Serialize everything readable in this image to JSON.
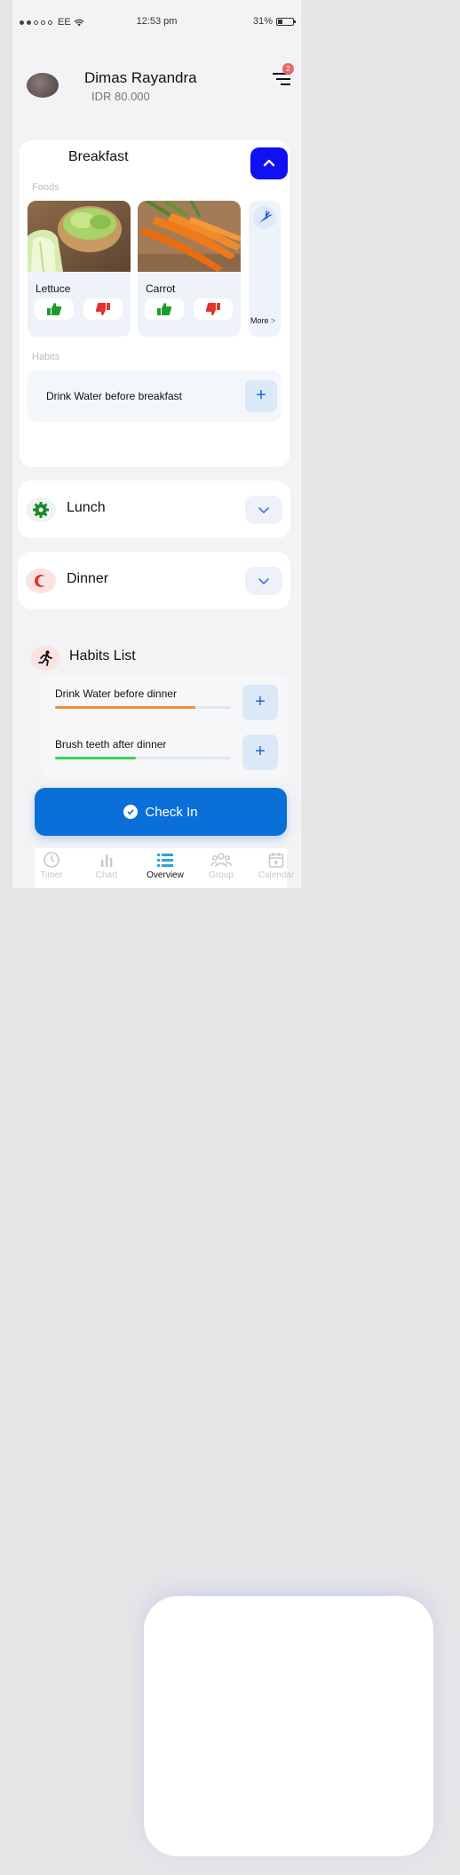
{
  "status_bar": {
    "carrier": "EE",
    "time": "12:53 pm",
    "battery": "31%",
    "battery_level": 0.31
  },
  "user": {
    "name": "Dimas Rayandra",
    "balance": "IDR 80.000",
    "notification_count": "2"
  },
  "breakfast": {
    "title": "Breakfast",
    "foods_label": "Foods",
    "foods": [
      {
        "name": "Lettuce",
        "image": "lettuce-photo"
      },
      {
        "name": "Carrot",
        "image": "carrot-photo"
      }
    ],
    "more_label": "More",
    "more_chevron": ">",
    "habits_label": "Habits",
    "habits": [
      {
        "name": "Drink Water before breakfast"
      }
    ]
  },
  "lunch": {
    "title": "Lunch",
    "icon": "gear-icon"
  },
  "dinner": {
    "title": "Dinner",
    "icon": "crescent-icon"
  },
  "habits_list": {
    "title": "Habits List",
    "items": [
      {
        "name": "Drink Water before dinner",
        "progress": 0.8,
        "color": "#f28b30"
      },
      {
        "name": "Brush teeth after dinner",
        "progress": 0.46,
        "color": "#3dcf5a"
      }
    ]
  },
  "check_in": {
    "label": "Check In"
  },
  "tabs": [
    {
      "label": "Timer",
      "icon": "clock-icon"
    },
    {
      "label": "Chart",
      "icon": "bar-chart-icon"
    },
    {
      "label": "Overview",
      "icon": "list-icon",
      "active": true
    },
    {
      "label": "Group",
      "icon": "group-icon"
    },
    {
      "label": "Calendar",
      "icon": "calendar-icon"
    }
  ],
  "colors": {
    "primary": "#0b6fd8",
    "accent_blue": "#1010f0",
    "like": "#1a9e2b",
    "dislike": "#e2332d"
  }
}
